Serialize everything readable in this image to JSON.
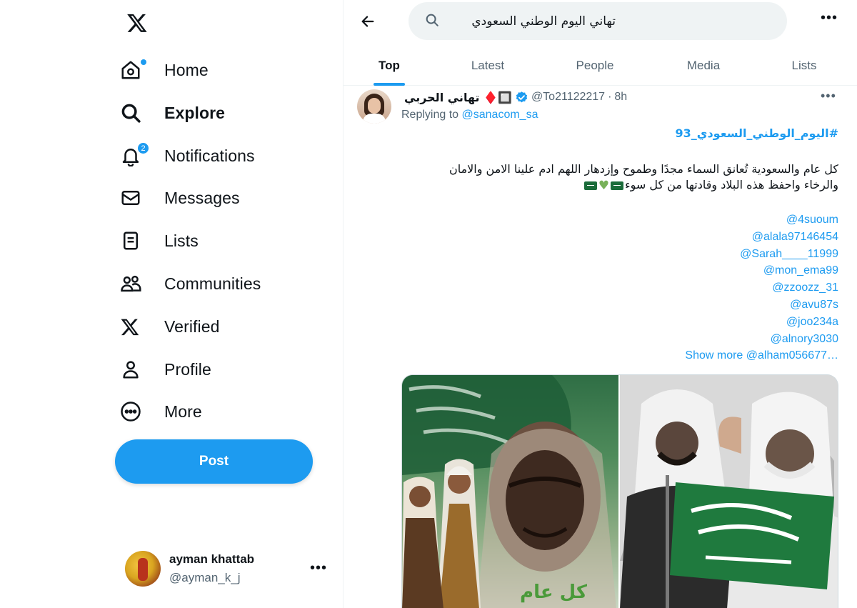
{
  "sidebar": {
    "logo_icon": "x-logo-icon",
    "items": [
      {
        "label": "Home",
        "icon": "home-icon",
        "active": false
      },
      {
        "label": "Explore",
        "icon": "search-icon",
        "active": true
      },
      {
        "label": "Notifications",
        "icon": "bell-icon",
        "badge": "2"
      },
      {
        "label": "Messages",
        "icon": "envelope-icon"
      },
      {
        "label": "Lists",
        "icon": "list-icon"
      },
      {
        "label": "Communities",
        "icon": "people-icon"
      },
      {
        "label": "Verified",
        "icon": "x-logo-icon"
      },
      {
        "label": "Profile",
        "icon": "person-icon"
      },
      {
        "label": "More",
        "icon": "more-circle-icon"
      }
    ],
    "post_label": "Post",
    "account": {
      "name": "ayman khattab",
      "handle": "@ayman_k_j"
    }
  },
  "search": {
    "value": "تهاني اليوم الوطني السعودي"
  },
  "tabs": [
    {
      "label": "Top",
      "active": true
    },
    {
      "label": "Latest",
      "active": false
    },
    {
      "label": "People",
      "active": false
    },
    {
      "label": "Media",
      "active": false
    },
    {
      "label": "Lists",
      "active": false
    }
  ],
  "tweet": {
    "name": "تهاني الحربي ♦️🔲",
    "handle": "@To21122217",
    "time": "8h",
    "replying_label": "Replying to",
    "replying_to": "@sanacom_sa",
    "hashtag": "#اليوم_الوطني_السعودي_93",
    "line1": "كل عام والسعودية تُعانق السماء مجدًا وطموح  وإزدهار  اللهم ادم علينا الامن والامان",
    "line2": "والرخاء واحفظ هذه البلاد  وقادتها من كل سوء",
    "mentions": [
      "@4suoum",
      "@alala97146454",
      "@Sarah____11999",
      "@mon_ema99",
      "@zzoozz_31",
      "@avu87s",
      "@joo234a",
      "@alnory3030"
    ],
    "last_mention": "@alham056677…",
    "show_more": "Show more",
    "media_caption": "كل عام"
  },
  "colors": {
    "accent": "#1d9bf0",
    "text_primary": "#0f1419",
    "text_secondary": "#536471",
    "verified": "#1d9bf0",
    "heart_green": "#78b159"
  }
}
